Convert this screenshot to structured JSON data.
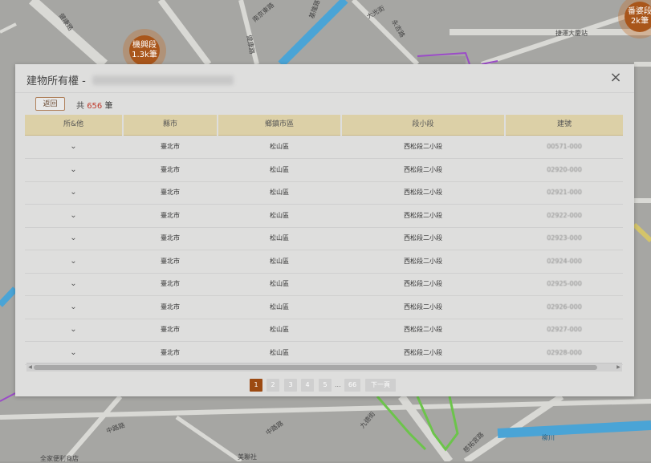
{
  "map": {
    "clusters": [
      {
        "name": "機興段",
        "count": "1.3k筆"
      },
      {
        "name": "番婆段",
        "count": "2k筆"
      }
    ],
    "labels": [
      "健康路",
      "南京東路",
      "基隆路",
      "大光街",
      "健康路",
      "永吉路",
      "捷運大慶站",
      "中路路",
      "中路路",
      "柳川",
      "美聯社",
      "全家便利商店",
      "九德街",
      "慈祐宮路"
    ],
    "colors": {
      "road": "#d7d7d3",
      "river": "#4aa4d6",
      "green": "#6cc44b",
      "purple": "#9b4bc8",
      "bg": "#a8a8a5"
    }
  },
  "dialog": {
    "title": "建物所有權 - ",
    "close_icon": "×",
    "back_label": "返回",
    "total_prefix": "共",
    "total_count": "656",
    "total_suffix": "筆",
    "columns": [
      "所&他",
      "縣市",
      "鄉鎮市區",
      "段小段",
      "建號"
    ],
    "rows": [
      {
        "city": "臺北市",
        "district": "松山區",
        "section": "西松段二小段",
        "building_no": "00571-000"
      },
      {
        "city": "臺北市",
        "district": "松山區",
        "section": "西松段二小段",
        "building_no": "02920-000"
      },
      {
        "city": "臺北市",
        "district": "松山區",
        "section": "西松段二小段",
        "building_no": "02921-000"
      },
      {
        "city": "臺北市",
        "district": "松山區",
        "section": "西松段二小段",
        "building_no": "02922-000"
      },
      {
        "city": "臺北市",
        "district": "松山區",
        "section": "西松段二小段",
        "building_no": "02923-000"
      },
      {
        "city": "臺北市",
        "district": "松山區",
        "section": "西松段二小段",
        "building_no": "02924-000"
      },
      {
        "city": "臺北市",
        "district": "松山區",
        "section": "西松段二小段",
        "building_no": "02925-000"
      },
      {
        "city": "臺北市",
        "district": "松山區",
        "section": "西松段二小段",
        "building_no": "02926-000"
      },
      {
        "city": "臺北市",
        "district": "松山區",
        "section": "西松段二小段",
        "building_no": "02927-000"
      },
      {
        "city": "臺北市",
        "district": "松山區",
        "section": "西松段二小段",
        "building_no": "02928-000"
      }
    ],
    "pagination": {
      "pages": [
        "1",
        "2",
        "3",
        "4",
        "5"
      ],
      "ellipsis": "...",
      "last_page": "66",
      "next_label": "下一頁",
      "current": "1"
    }
  }
}
